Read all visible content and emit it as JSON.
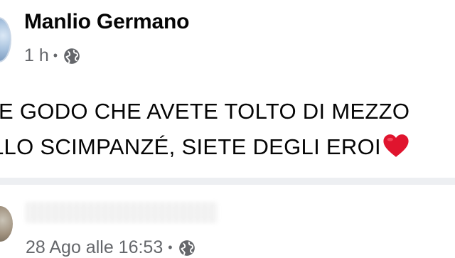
{
  "post": {
    "author": "Manlio Germano",
    "time": "1 h",
    "separator": "•",
    "audience_icon": "globe-icon",
    "lines": [
      "E GODO CHE AVETE TOLTO DI MEZZO",
      "LLO SCIMPANZÉ, SIETE DEGLI EROI"
    ],
    "emoji": "red-heart",
    "heart_color": "#e0142e"
  },
  "next_post": {
    "time": "28 Ago alle 16:53",
    "separator": "•",
    "audience_icon": "globe-icon"
  },
  "colors": {
    "text": "#050505",
    "meta": "#65676b",
    "divider": "#edeff2"
  }
}
